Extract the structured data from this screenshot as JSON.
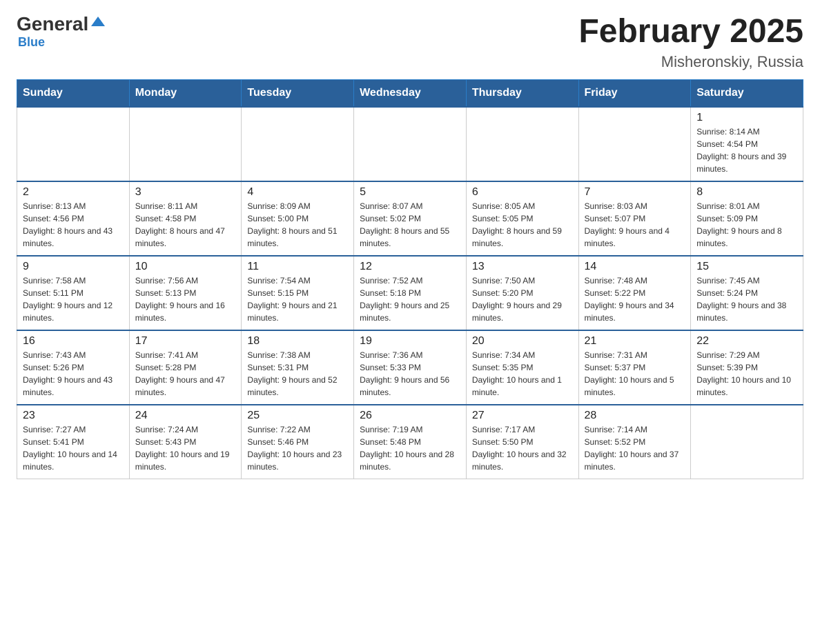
{
  "header": {
    "logo_general": "General",
    "logo_blue": "Blue",
    "title": "February 2025",
    "subtitle": "Misheronskiy, Russia"
  },
  "weekdays": [
    "Sunday",
    "Monday",
    "Tuesday",
    "Wednesday",
    "Thursday",
    "Friday",
    "Saturday"
  ],
  "weeks": [
    [
      {
        "day": "",
        "info": ""
      },
      {
        "day": "",
        "info": ""
      },
      {
        "day": "",
        "info": ""
      },
      {
        "day": "",
        "info": ""
      },
      {
        "day": "",
        "info": ""
      },
      {
        "day": "",
        "info": ""
      },
      {
        "day": "1",
        "info": "Sunrise: 8:14 AM\nSunset: 4:54 PM\nDaylight: 8 hours and 39 minutes."
      }
    ],
    [
      {
        "day": "2",
        "info": "Sunrise: 8:13 AM\nSunset: 4:56 PM\nDaylight: 8 hours and 43 minutes."
      },
      {
        "day": "3",
        "info": "Sunrise: 8:11 AM\nSunset: 4:58 PM\nDaylight: 8 hours and 47 minutes."
      },
      {
        "day": "4",
        "info": "Sunrise: 8:09 AM\nSunset: 5:00 PM\nDaylight: 8 hours and 51 minutes."
      },
      {
        "day": "5",
        "info": "Sunrise: 8:07 AM\nSunset: 5:02 PM\nDaylight: 8 hours and 55 minutes."
      },
      {
        "day": "6",
        "info": "Sunrise: 8:05 AM\nSunset: 5:05 PM\nDaylight: 8 hours and 59 minutes."
      },
      {
        "day": "7",
        "info": "Sunrise: 8:03 AM\nSunset: 5:07 PM\nDaylight: 9 hours and 4 minutes."
      },
      {
        "day": "8",
        "info": "Sunrise: 8:01 AM\nSunset: 5:09 PM\nDaylight: 9 hours and 8 minutes."
      }
    ],
    [
      {
        "day": "9",
        "info": "Sunrise: 7:58 AM\nSunset: 5:11 PM\nDaylight: 9 hours and 12 minutes."
      },
      {
        "day": "10",
        "info": "Sunrise: 7:56 AM\nSunset: 5:13 PM\nDaylight: 9 hours and 16 minutes."
      },
      {
        "day": "11",
        "info": "Sunrise: 7:54 AM\nSunset: 5:15 PM\nDaylight: 9 hours and 21 minutes."
      },
      {
        "day": "12",
        "info": "Sunrise: 7:52 AM\nSunset: 5:18 PM\nDaylight: 9 hours and 25 minutes."
      },
      {
        "day": "13",
        "info": "Sunrise: 7:50 AM\nSunset: 5:20 PM\nDaylight: 9 hours and 29 minutes."
      },
      {
        "day": "14",
        "info": "Sunrise: 7:48 AM\nSunset: 5:22 PM\nDaylight: 9 hours and 34 minutes."
      },
      {
        "day": "15",
        "info": "Sunrise: 7:45 AM\nSunset: 5:24 PM\nDaylight: 9 hours and 38 minutes."
      }
    ],
    [
      {
        "day": "16",
        "info": "Sunrise: 7:43 AM\nSunset: 5:26 PM\nDaylight: 9 hours and 43 minutes."
      },
      {
        "day": "17",
        "info": "Sunrise: 7:41 AM\nSunset: 5:28 PM\nDaylight: 9 hours and 47 minutes."
      },
      {
        "day": "18",
        "info": "Sunrise: 7:38 AM\nSunset: 5:31 PM\nDaylight: 9 hours and 52 minutes."
      },
      {
        "day": "19",
        "info": "Sunrise: 7:36 AM\nSunset: 5:33 PM\nDaylight: 9 hours and 56 minutes."
      },
      {
        "day": "20",
        "info": "Sunrise: 7:34 AM\nSunset: 5:35 PM\nDaylight: 10 hours and 1 minute."
      },
      {
        "day": "21",
        "info": "Sunrise: 7:31 AM\nSunset: 5:37 PM\nDaylight: 10 hours and 5 minutes."
      },
      {
        "day": "22",
        "info": "Sunrise: 7:29 AM\nSunset: 5:39 PM\nDaylight: 10 hours and 10 minutes."
      }
    ],
    [
      {
        "day": "23",
        "info": "Sunrise: 7:27 AM\nSunset: 5:41 PM\nDaylight: 10 hours and 14 minutes."
      },
      {
        "day": "24",
        "info": "Sunrise: 7:24 AM\nSunset: 5:43 PM\nDaylight: 10 hours and 19 minutes."
      },
      {
        "day": "25",
        "info": "Sunrise: 7:22 AM\nSunset: 5:46 PM\nDaylight: 10 hours and 23 minutes."
      },
      {
        "day": "26",
        "info": "Sunrise: 7:19 AM\nSunset: 5:48 PM\nDaylight: 10 hours and 28 minutes."
      },
      {
        "day": "27",
        "info": "Sunrise: 7:17 AM\nSunset: 5:50 PM\nDaylight: 10 hours and 32 minutes."
      },
      {
        "day": "28",
        "info": "Sunrise: 7:14 AM\nSunset: 5:52 PM\nDaylight: 10 hours and 37 minutes."
      },
      {
        "day": "",
        "info": ""
      }
    ]
  ]
}
